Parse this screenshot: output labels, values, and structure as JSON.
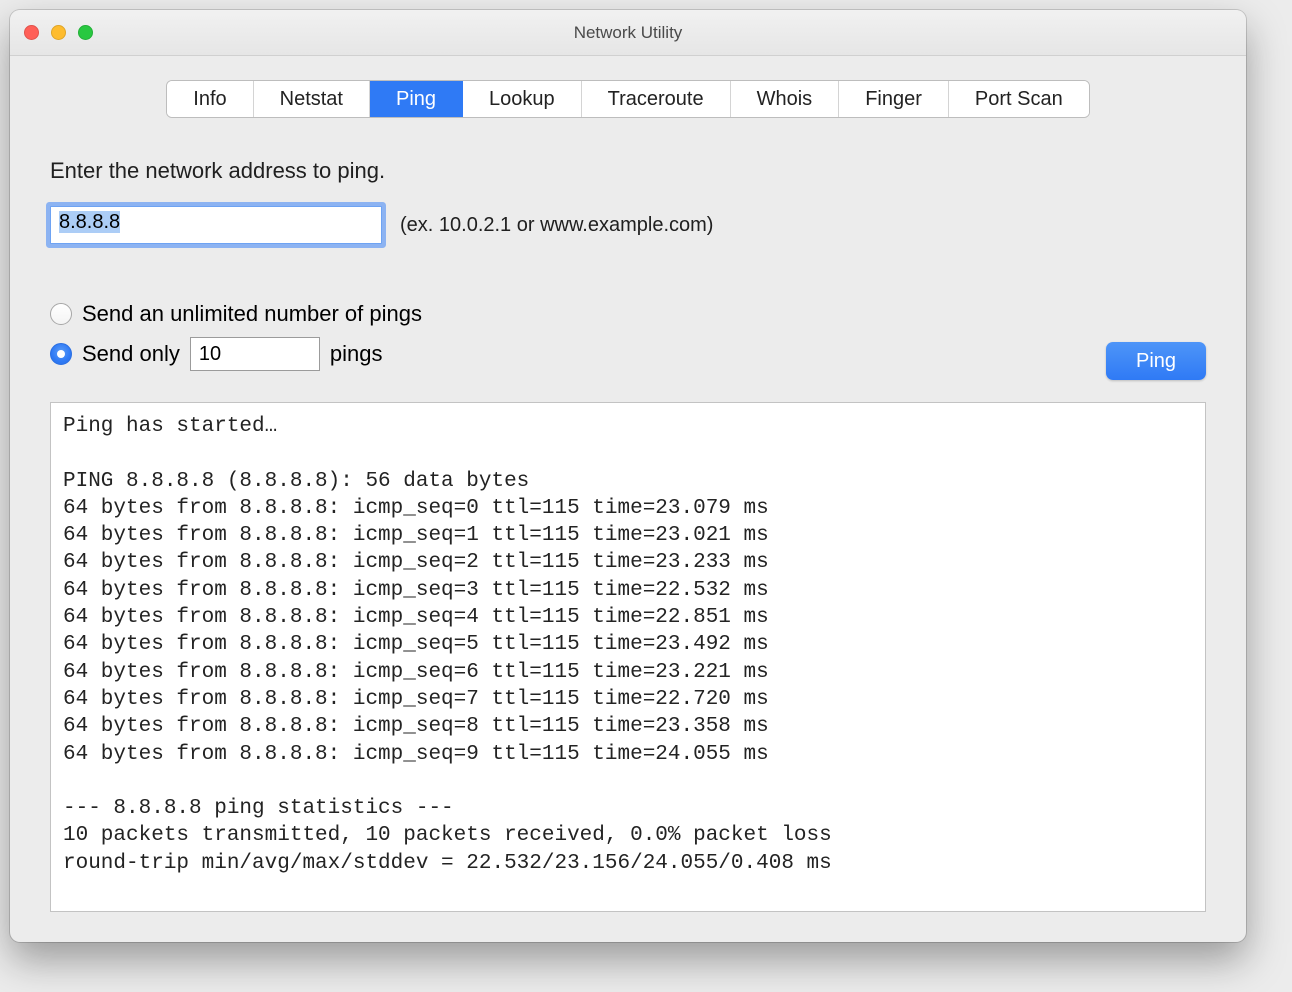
{
  "window": {
    "title": "Network Utility"
  },
  "tabs": [
    {
      "label": "Info",
      "active": false
    },
    {
      "label": "Netstat",
      "active": false
    },
    {
      "label": "Ping",
      "active": true
    },
    {
      "label": "Lookup",
      "active": false
    },
    {
      "label": "Traceroute",
      "active": false
    },
    {
      "label": "Whois",
      "active": false
    },
    {
      "label": "Finger",
      "active": false
    },
    {
      "label": "Port Scan",
      "active": false
    }
  ],
  "form": {
    "prompt": "Enter the network address to ping.",
    "address_value": "8.8.8.8",
    "hint": "(ex. 10.0.2.1 or www.example.com)",
    "unlimited_label": "Send an unlimited number of pings",
    "send_only_label": "Send only",
    "send_only_suffix": "pings",
    "count_value": "10",
    "selected_option": "send_only"
  },
  "actions": {
    "ping_button": "Ping"
  },
  "output_lines": [
    "Ping has started…",
    "",
    "PING 8.8.8.8 (8.8.8.8): 56 data bytes",
    "64 bytes from 8.8.8.8: icmp_seq=0 ttl=115 time=23.079 ms",
    "64 bytes from 8.8.8.8: icmp_seq=1 ttl=115 time=23.021 ms",
    "64 bytes from 8.8.8.8: icmp_seq=2 ttl=115 time=23.233 ms",
    "64 bytes from 8.8.8.8: icmp_seq=3 ttl=115 time=22.532 ms",
    "64 bytes from 8.8.8.8: icmp_seq=4 ttl=115 time=22.851 ms",
    "64 bytes from 8.8.8.8: icmp_seq=5 ttl=115 time=23.492 ms",
    "64 bytes from 8.8.8.8: icmp_seq=6 ttl=115 time=23.221 ms",
    "64 bytes from 8.8.8.8: icmp_seq=7 ttl=115 time=22.720 ms",
    "64 bytes from 8.8.8.8: icmp_seq=8 ttl=115 time=23.358 ms",
    "64 bytes from 8.8.8.8: icmp_seq=9 ttl=115 time=24.055 ms",
    "",
    "--- 8.8.8.8 ping statistics ---",
    "10 packets transmitted, 10 packets received, 0.0% packet loss",
    "round-trip min/avg/max/stddev = 22.532/23.156/24.055/0.408 ms"
  ]
}
